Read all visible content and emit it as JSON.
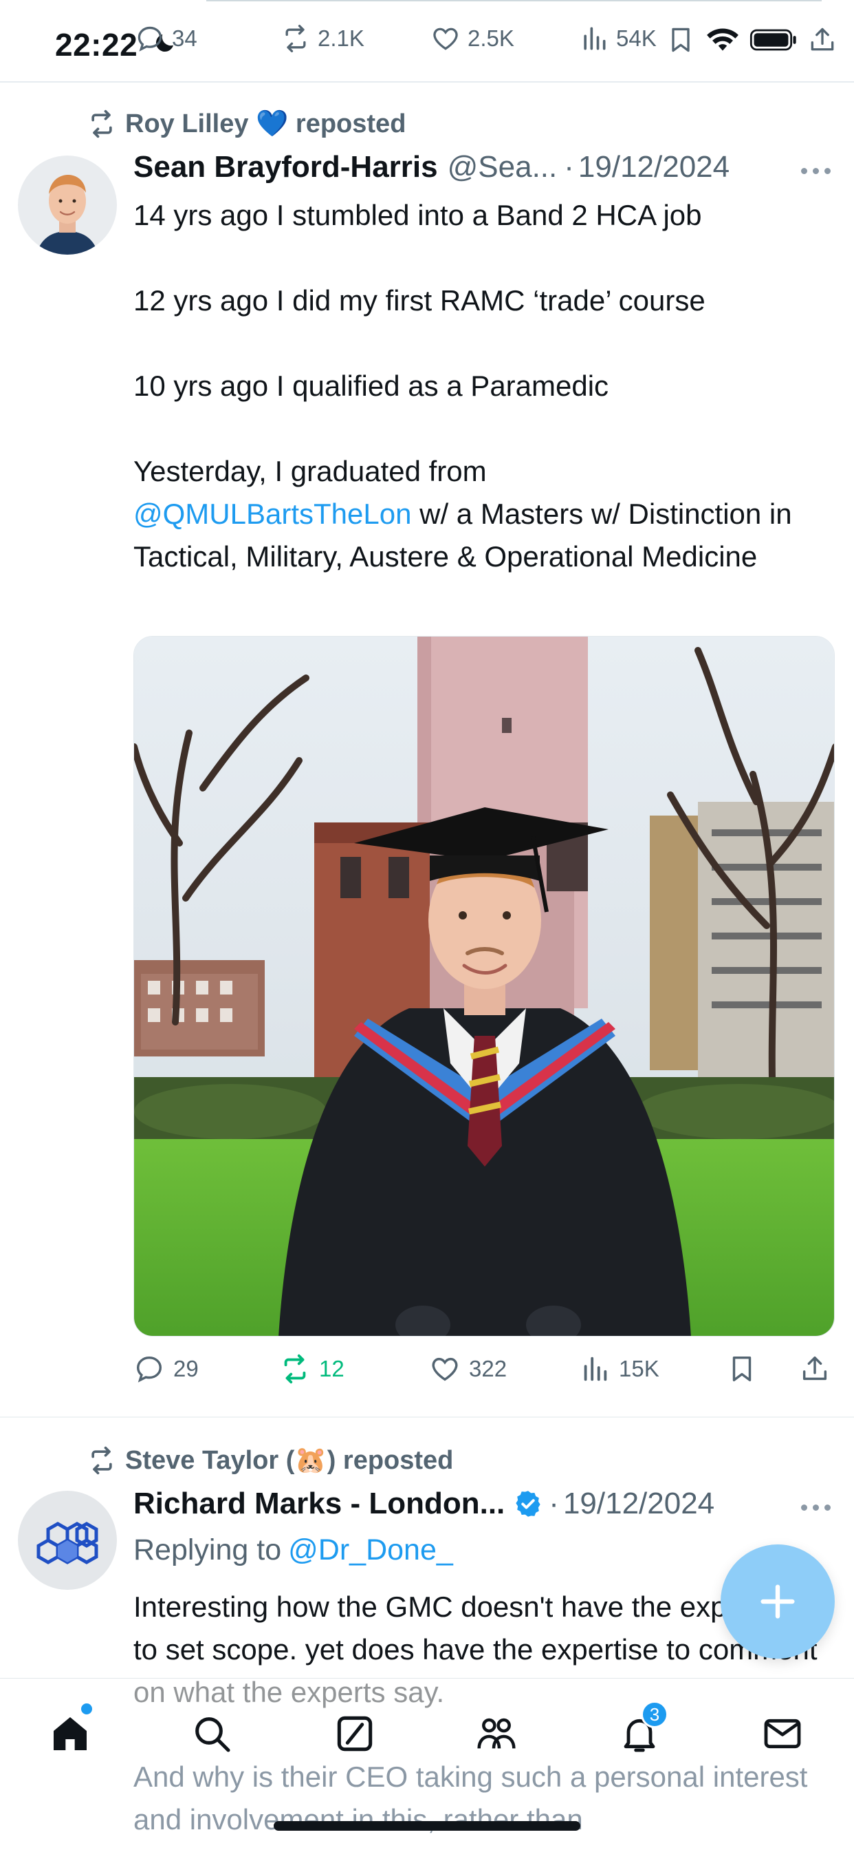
{
  "status_bar": {
    "time": "22:22"
  },
  "top_stats": {
    "replies": "34",
    "reposts": "2.1K",
    "likes": "2.5K",
    "views": "54K"
  },
  "post1": {
    "reposted_by": "Roy Lilley 💙 reposted",
    "author_name": "Sean Brayford-Harris",
    "handle": "@Sea...",
    "separator": "·",
    "date": "19/12/2024",
    "paragraphs": [
      "14 yrs ago I stumbled into a Band 2 HCA job",
      "12 yrs ago I did my first RAMC ‘trade’ course",
      "10 yrs ago I qualified as a Paramedic"
    ],
    "last_paragraph_before": "Yesterday, I graduated from ",
    "mention": "@QMULBartsTheLon",
    "last_paragraph_after": " w/ a Masters w/ Distinction in Tactical, Military, Austere & Operational Medicine",
    "stats": {
      "replies": "29",
      "reposts": "12",
      "likes": "322",
      "views": "15K"
    }
  },
  "post2": {
    "reposted_by": "Steve Taylor (🐹) reposted",
    "author_name": "Richard Marks - London...",
    "separator": "·",
    "date": "19/12/2024",
    "replying_prefix": "Replying to ",
    "replying_to": "@Dr_Done_",
    "text": "Interesting how the GMC doesn't have the expertise to set scope. yet does have the expertise to comment on what the experts say.",
    "text2": "And why is their CEO taking such a personal interest and involvement in this, rather than"
  },
  "nav": {
    "notifications_badge": "3"
  },
  "colors": {
    "accent": "#1d9bf0",
    "repost_green": "#00ba7c",
    "muted": "#536471"
  }
}
